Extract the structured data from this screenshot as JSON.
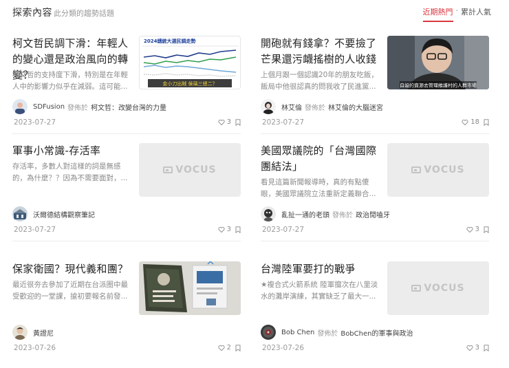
{
  "header": {
    "title": "探索內容",
    "subtitle": "此分類的趨勢話題",
    "sort_recent": "近期熱門",
    "sort_separator": "·",
    "sort_total": "累計人氣"
  },
  "published_label": "發佈於",
  "placeholder_logo": "VOCUS",
  "colors": {
    "accent": "#d9373f",
    "divider": "#ebebeb",
    "muted": "#9a9a9a"
  },
  "articles": [
    {
      "title": "柯文哲民調下滑：年輕人的變心還是政治風向的轉變？",
      "excerpt": "柯文哲的支持度下滑，特別是在年輕人中的影響力似乎在減弱。這可能...",
      "author": "SDFusion",
      "publication": "柯文哲：改變台灣的力量",
      "date": "2023-07-27",
      "likes": "3",
      "thumb_type": "chart",
      "thumb_chart_title": "2024總統大選民調走勢",
      "thumb_caption": "金小刀出賊 侯璃三總二？"
    },
    {
      "title": "開砲就有錢拿？不要撿了芒果還污衊搖樹的人收錢",
      "excerpt": "上個月跟一個認識20年的朋友吃飯，飯局中他很認真的問我收了民進黨...",
      "author": "林艾倫",
      "publication": "林艾倫的大腦迷宮",
      "date": "2023-07-27",
      "likes": "18",
      "thumb_type": "video",
      "thumb_caption": "自設的資源去管理維護村的人群市場"
    },
    {
      "title": "軍事小常識-存活率",
      "excerpt": "存活率，多數人對這樣的詞是無感的，為什麼？？因為不需要面對，...",
      "author": "沃爾德結構觀察筆記",
      "publication": "",
      "date": "2023-07-27",
      "likes": "3",
      "thumb_type": "placeholder"
    },
    {
      "title": "美國眾議院的「台灣國際團結法」",
      "excerpt": "看見這篇新聞報導時，真的有點傻眼，美國眾議院立法重新定義聯合...",
      "author": "亂扯一通的老頭",
      "publication": "政治閒嗑牙",
      "date": "2023-07-27",
      "likes": "3",
      "thumb_type": "placeholder"
    },
    {
      "title": "保家衛國？現代義和團？",
      "excerpt": "最近很夯去參加了近期在台派圈中最受歡迎的一堂課，搶初要報名前發...",
      "author": "黃證尼",
      "publication": "",
      "date": "2023-07-26",
      "likes": "2",
      "thumb_type": "book"
    },
    {
      "title": "台灣陸軍要打的戰爭",
      "excerpt": "★複合式火箭系統 陸軍擅次在八里淡水的灘岸演練，其實缺乏了最大一...",
      "author": "Bob Chen",
      "publication": "BobChen的軍事與政治",
      "date": "2023-07-26",
      "likes": "3",
      "thumb_type": "placeholder"
    }
  ]
}
